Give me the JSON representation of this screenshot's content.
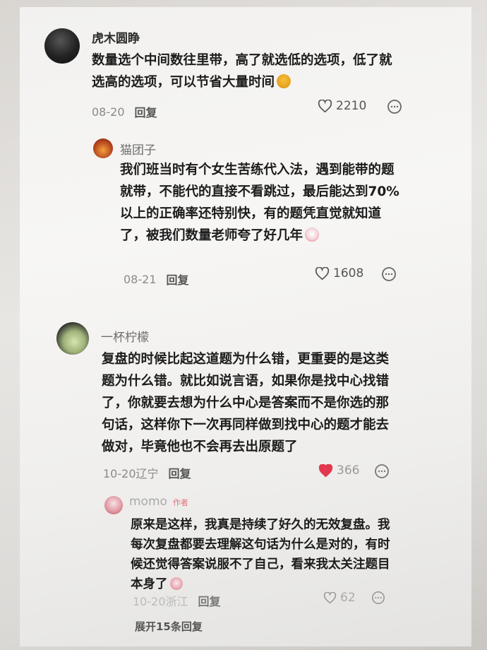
{
  "colors": {
    "like_active": "#e2384d",
    "author_tag": "#e2707a",
    "text": "#1c1c1c",
    "meta": "#8a8a8a"
  },
  "comments": [
    {
      "username": "虎木圆睁",
      "text": "数量选个中间数往里带，高了就选低的选项，低了就选高的选项，可以节省大量时间",
      "date": "08-20",
      "reply_label": "回复",
      "likes": "2210",
      "liked": false,
      "emoji": "sunglasses-emoji"
    },
    {
      "username": "猫团子",
      "text": "我们班当时有个女生苦练代入法，遇到能带的题就带，不能代的直接不看跳过，最后能达到70%以上的正确率还特别快，有的题凭直觉就知道了，被我们数量老师夸了好几年",
      "date": "08-21",
      "reply_label": "回复",
      "likes": "1608",
      "liked": false,
      "emoji": "clown-emoji"
    },
    {
      "username": "一杯柠檬",
      "text": "复盘的时候比起这道题为什么错，更重要的是这类题为什么错。就比如说言语，如果你是找中心找错了，你就要去想为什么中心是答案而不是你选的那句话，这样你下一次再同样做到找中心的题才能去做对，毕竟他也不会再去出原题了",
      "date": "10-20辽宁",
      "reply_label": "回复",
      "likes": "366",
      "liked": true
    },
    {
      "username": "momo",
      "author_tag": "作者",
      "text": "原来是这样，我真是持续了好久的无效复盘。我每次复盘都要去理解这句话为什么是对的，有时候还觉得答案说服不了自己，看来我太关注题目本身了",
      "date": "10-20浙江",
      "reply_label": "回复",
      "likes": "62",
      "liked": false,
      "emoji": "crying-emoji"
    }
  ],
  "expand_replies": "展开15条回复"
}
